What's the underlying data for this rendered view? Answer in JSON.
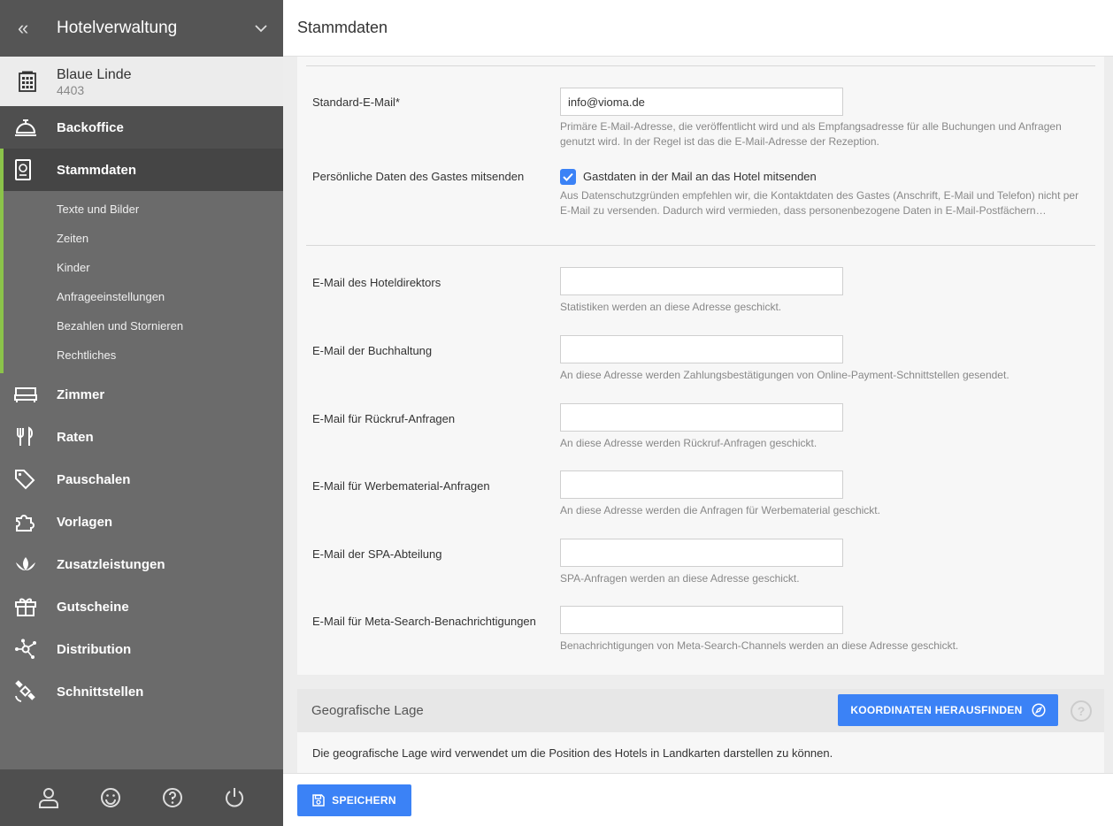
{
  "sidebar": {
    "app_title": "Hotelverwaltung",
    "collapse_icon": "double-chevron-left-icon",
    "hotel": {
      "name": "Blaue Linde",
      "id": "4403"
    },
    "backoffice_label": "Backoffice",
    "active_label": "Stammdaten",
    "sub_items": [
      "Texte und Bilder",
      "Zeiten",
      "Kinder",
      "Anfrageeinstellungen",
      "Bezahlen und Stornieren",
      "Rechtliches"
    ],
    "items": [
      {
        "label": "Zimmer",
        "icon": "bed-icon"
      },
      {
        "label": "Raten",
        "icon": "cutlery-icon"
      },
      {
        "label": "Pauschalen",
        "icon": "tags-icon"
      },
      {
        "label": "Vorlagen",
        "icon": "puzzle-icon"
      },
      {
        "label": "Zusatzleistungen",
        "icon": "lotus-icon"
      },
      {
        "label": "Gutscheine",
        "icon": "gift-icon"
      },
      {
        "label": "Distribution",
        "icon": "network-icon"
      },
      {
        "label": "Schnittstellen",
        "icon": "satellite-icon"
      }
    ]
  },
  "header": {
    "title": "Stammdaten"
  },
  "form": {
    "standard_email": {
      "label": "Standard-E-Mail*",
      "value": "info@vioma.de",
      "help_1": "Primäre E-Mail-Adresse, die veröffentlicht wird und als Empfangsadresse für alle Buchungen und Anfragen",
      "help_2": "genutzt wird. In der Regel ist das die E-Mail-Adresse der Rezeption."
    },
    "guest_data": {
      "label": "Persönliche Daten des Gastes mitsenden",
      "checkbox_label": "Gastdaten in der Mail an das Hotel mitsenden",
      "checked": true,
      "help_1": "Aus Datenschutzgründen empfehlen wir, die Kontaktdaten des Gastes (Anschrift, E-Mail und Telefon) nicht per",
      "help_2": "E-Mail zu versenden. Dadurch wird vermieden, dass personenbezogene Daten in E-Mail-Postfächern…"
    },
    "fields": [
      {
        "label": "E-Mail des Hoteldirektors",
        "value": "",
        "help": "Statistiken werden an diese Adresse geschickt."
      },
      {
        "label": "E-Mail der Buchhaltung",
        "value": "",
        "help": "An diese Adresse werden Zahlungsbestätigungen von Online-Payment-Schnittstellen gesendet."
      },
      {
        "label": "E-Mail für Rückruf-Anfragen",
        "value": "",
        "help": "An diese Adresse werden Rückruf-Anfragen geschickt."
      },
      {
        "label": "E-Mail für Werbematerial-Anfragen",
        "value": "",
        "help": "An diese Adresse werden die Anfragen für Werbematerial geschickt."
      },
      {
        "label": "E-Mail der SPA-Abteilung",
        "value": "",
        "help": "SPA-Anfragen werden an diese Adresse geschickt."
      },
      {
        "label": "E-Mail für Meta-Search-Benachrichtigungen",
        "value": "",
        "help": "Benachrichtigungen von Meta-Search-Channels werden an diese Adresse geschickt."
      }
    ]
  },
  "geo": {
    "title": "Geografische Lage",
    "button_label": "KOORDINATEN HERAUSFINDEN",
    "help_glyph": "?",
    "text": "Die geografische Lage wird verwendet um die Position des Hotels in Landkarten darstellen zu können."
  },
  "footer": {
    "save_label": "SPEICHERN"
  },
  "colors": {
    "accent": "#3b82f6",
    "active_bar": "#8bc34a",
    "sidebar": "#6b6b6b"
  }
}
